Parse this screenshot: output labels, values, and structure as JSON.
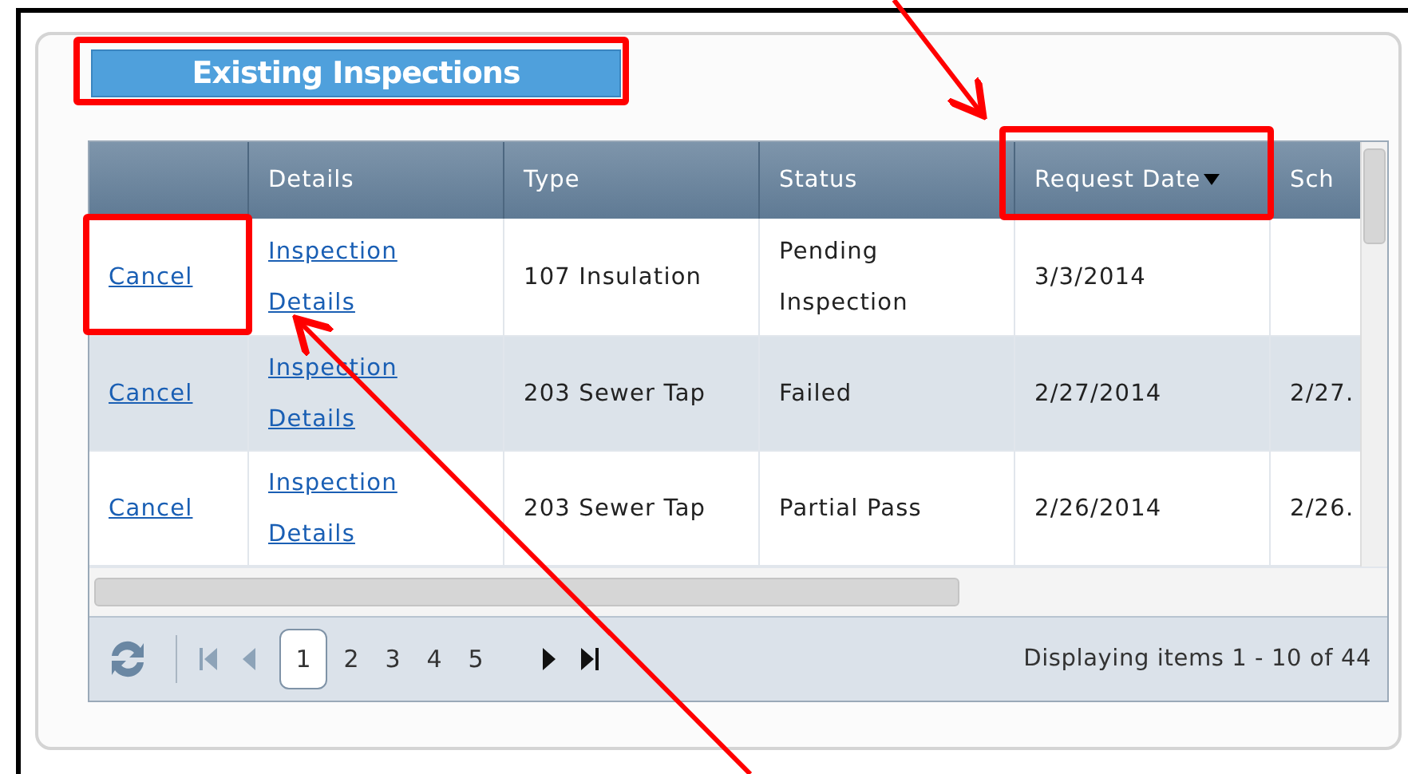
{
  "panel": {
    "title": "Existing Inspections"
  },
  "table": {
    "columns": [
      {
        "sorted": false
      },
      {
        "label": "Details",
        "sorted": false
      },
      {
        "label": "Type",
        "sorted": false
      },
      {
        "label": "Status",
        "sorted": false
      },
      {
        "label": "Request Date",
        "sorted": true
      },
      {
        "label": "Sch",
        "sorted": false
      }
    ],
    "rows": [
      {
        "cancel": "Cancel",
        "details": "Inspection Details",
        "type": "107 Insulation",
        "status": "Pending Inspection",
        "request_date": "3/3/2014"
      },
      {
        "cancel": "Cancel",
        "details": "Inspection Details",
        "type": "203 Sewer Tap",
        "status": "Failed",
        "request_date": "2/27/2014",
        "column_6": "2/27."
      },
      {
        "cancel": "Cancel",
        "details": "Inspection Details",
        "type": "203 Sewer Tap",
        "status": "Partial Pass",
        "request_date": "2/26/2014",
        "column_6": "2/26."
      }
    ]
  },
  "pager": {
    "pages": [
      {
        "label": "1",
        "selected": true
      },
      {
        "label": "2",
        "selected": false
      },
      {
        "label": "3",
        "selected": false
      },
      {
        "label": "4",
        "selected": false
      },
      {
        "label": "5",
        "selected": false
      }
    ],
    "summary": "Displaying items 1 - 10 of 44"
  }
}
